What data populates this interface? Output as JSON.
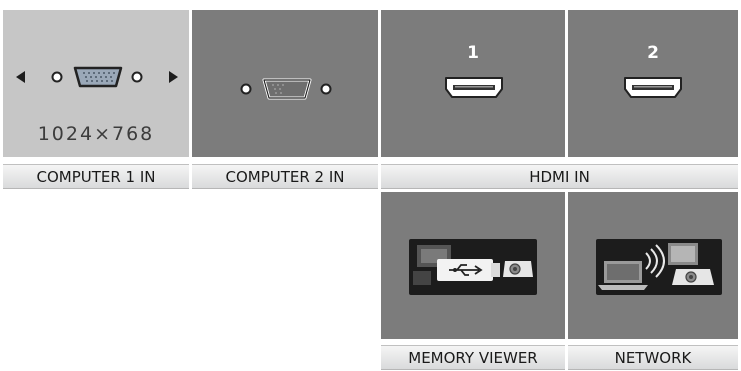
{
  "inputs": {
    "computer1": {
      "label": "COMPUTER 1 IN",
      "resolution": "1024×768",
      "selected": true
    },
    "computer2": {
      "label": "COMPUTER 2 IN"
    },
    "hdmi": {
      "label": "HDMI IN",
      "port1": "1",
      "port2": "2"
    },
    "memory_viewer": {
      "label": "MEMORY VIEWER"
    },
    "network": {
      "label": "NETWORK"
    }
  },
  "icons": {
    "left": "left-arrow-icon",
    "right": "right-arrow-icon",
    "vga": "vga-port-icon",
    "hdmi": "hdmi-port-icon",
    "memory": "usb-memory-icon",
    "network": "network-icon"
  },
  "colors": {
    "selected_tile": "#c6c6c6",
    "tile": "#7c7c7c"
  }
}
